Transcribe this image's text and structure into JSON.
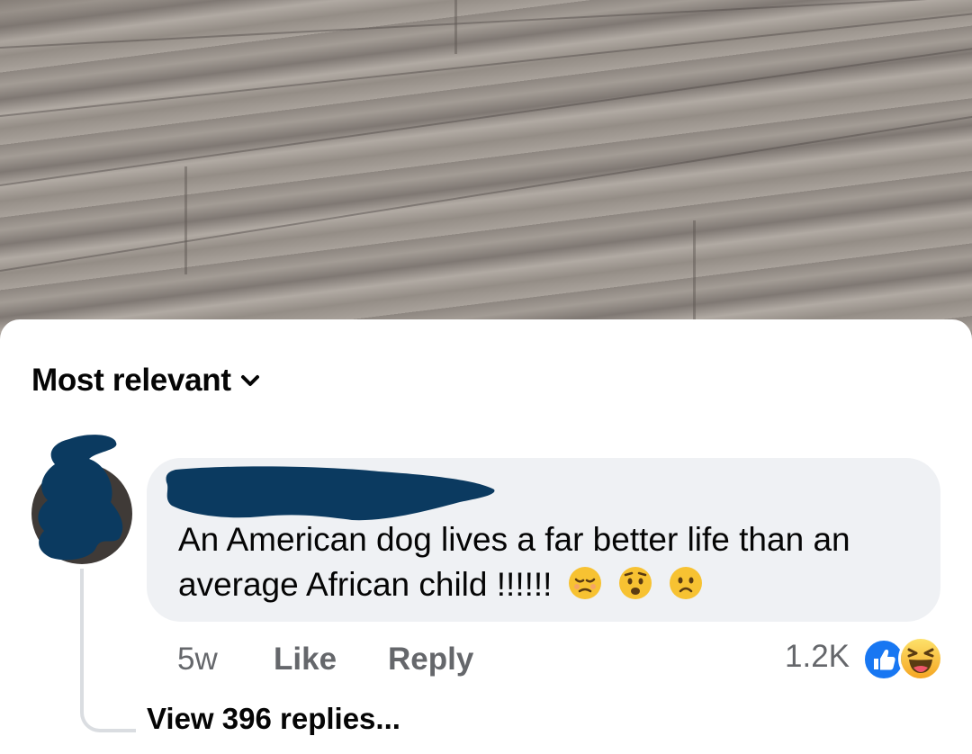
{
  "sort": {
    "label": "Most relevant",
    "icon": "chevron-down-icon"
  },
  "comment": {
    "text": "An American dog lives a far better life than an average African child !!!!!!",
    "emojis": [
      "pensive-face-icon",
      "worried-face-icon",
      "frowning-face-icon"
    ],
    "time": "5w",
    "like_label": "Like",
    "reply_label": "Reply",
    "reaction_count": "1.2K",
    "reaction_icons": [
      "like-reaction-icon",
      "haha-reaction-icon"
    ],
    "view_replies_label": "View 396 replies..."
  },
  "colors": {
    "bubble": "#eff1f4",
    "secondary_text": "#65676b",
    "like_blue": "#1877f2",
    "redaction": "#0b3a60"
  }
}
